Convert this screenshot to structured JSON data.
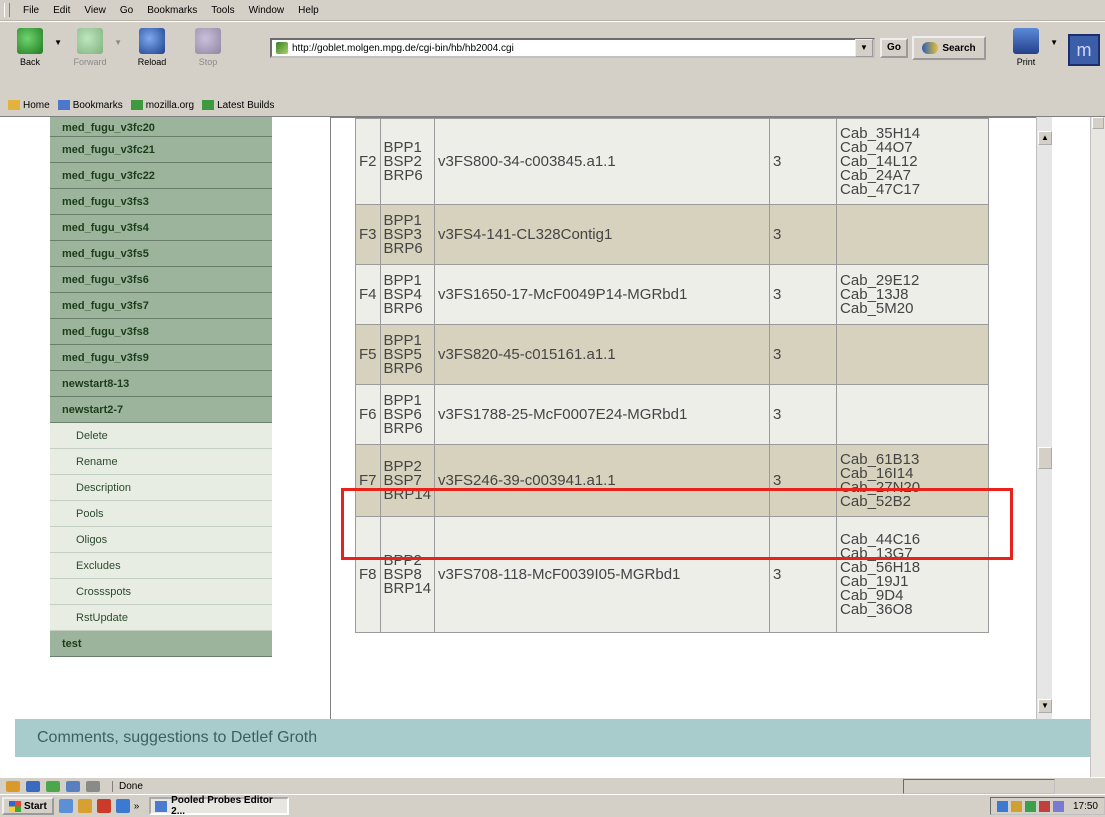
{
  "menu": [
    "File",
    "Edit",
    "View",
    "Go",
    "Bookmarks",
    "Tools",
    "Window",
    "Help"
  ],
  "toolbar": {
    "back": "Back",
    "forward": "Forward",
    "reload": "Reload",
    "stop": "Stop",
    "url": "http://goblet.molgen.mpg.de/cgi-bin/hb/hb2004.cgi",
    "go": "Go",
    "search": "Search",
    "print": "Print"
  },
  "personal_toolbar": [
    "Home",
    "Bookmarks",
    "mozilla.org",
    "Latest Builds"
  ],
  "sidebar": {
    "items": [
      {
        "label": "med_fugu_v3fc20"
      },
      {
        "label": "med_fugu_v3fc21"
      },
      {
        "label": "med_fugu_v3fc22"
      },
      {
        "label": "med_fugu_v3fs3"
      },
      {
        "label": "med_fugu_v3fs4"
      },
      {
        "label": "med_fugu_v3fs5"
      },
      {
        "label": "med_fugu_v3fs6"
      },
      {
        "label": "med_fugu_v3fs7"
      },
      {
        "label": "med_fugu_v3fs8"
      },
      {
        "label": "med_fugu_v3fs9"
      },
      {
        "label": "newstart8-13"
      },
      {
        "label": "newstart2-7"
      }
    ],
    "subitems": [
      {
        "label": "Delete"
      },
      {
        "label": "Rename"
      },
      {
        "label": "Description"
      },
      {
        "label": "Pools"
      },
      {
        "label": "Oligos"
      },
      {
        "label": "Excludes"
      },
      {
        "label": "Crossspots"
      },
      {
        "label": "RstUpdate"
      }
    ],
    "last": {
      "label": "test"
    }
  },
  "table": {
    "rows": [
      {
        "id": "F2",
        "pools": [
          "BPP1",
          "BSP2",
          "BRP6"
        ],
        "probe": "v3FS800-34-c003845.a1.1",
        "count": "3",
        "clones": [
          "Cab_35H14",
          "Cab_44O7",
          "Cab_14L12",
          "Cab_24A7",
          "Cab_47C17"
        ]
      },
      {
        "id": "F3",
        "pools": [
          "BPP1",
          "BSP3",
          "BRP6"
        ],
        "probe": "v3FS4-141-CL328Contig1",
        "count": "3",
        "clones": []
      },
      {
        "id": "F4",
        "pools": [
          "BPP1",
          "BSP4",
          "BRP6"
        ],
        "probe": "v3FS1650-17-McF0049P14-MGRbd1",
        "count": "3",
        "clones": [
          "Cab_29E12",
          "Cab_13J8",
          "Cab_5M20"
        ]
      },
      {
        "id": "F5",
        "pools": [
          "BPP1",
          "BSP5",
          "BRP6"
        ],
        "probe": "v3FS820-45-c015161.a1.1",
        "count": "3",
        "clones": []
      },
      {
        "id": "F6",
        "pools": [
          "BPP1",
          "BSP6",
          "BRP6"
        ],
        "probe": "v3FS1788-25-McF0007E24-MGRbd1",
        "count": "3",
        "clones": []
      },
      {
        "id": "F7",
        "pools": [
          "BPP2",
          "BSP7",
          "BRP14"
        ],
        "probe": "v3FS246-39-c003941.a1.1",
        "count": "3",
        "clones": [
          "Cab_61B13",
          "Cab_16I14",
          "Cab_27N20",
          "Cab_52B2"
        ]
      },
      {
        "id": "F8",
        "pools": [
          "BPP2",
          "BSP8",
          "BRP14"
        ],
        "probe": "v3FS708-118-McF0039I05-MGRbd1",
        "count": "3",
        "clones": [
          "Cab_44C16",
          "Cab_13G7",
          "Cab_56H18",
          "Cab_19J1",
          "Cab_9D4",
          "Cab_36O8"
        ]
      }
    ]
  },
  "footer": {
    "text": "Comments, suggestions to Detlef Groth"
  },
  "status": {
    "text": "Done"
  },
  "taskbar": {
    "start": "Start",
    "item": "Pooled Probes Editor 2...",
    "chevron": "»",
    "time": "17:50"
  }
}
